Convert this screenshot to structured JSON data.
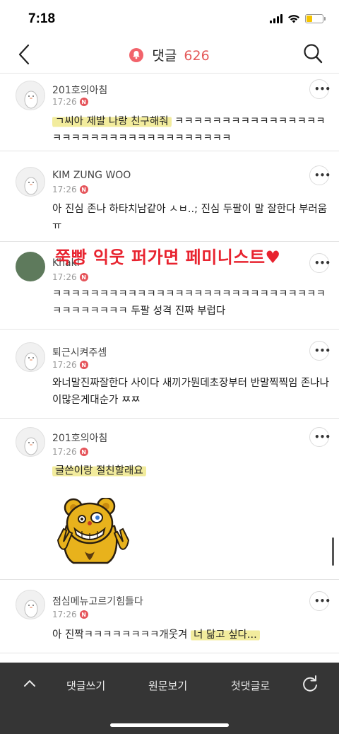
{
  "status_bar": {
    "time": "7:18"
  },
  "header": {
    "title": "댓글",
    "count": "626"
  },
  "overlay_caption": "쭉빵 익웃 퍼가면 페미니스트♥",
  "comments": [
    {
      "author": "201호의아침",
      "time": "17:26",
      "badge": "N",
      "text_highlight": "ㄱ씨아 제발 나랑 친구해줘",
      "text_rest": " ㅋㅋㅋㅋㅋㅋㅋㅋㅋㅋㅋㅋㅋㅋㅋㅋㅋㅋㅋㅋㅋㅋㅋㅋㅋㅋㅋㅋㅋㅋㅋㅋㅋㅋㅋ"
    },
    {
      "author": "KIM ZUNG WOO",
      "time": "17:26",
      "badge": "N",
      "text": "아 진심 존나 하타치남같아 ㅅㅂ..; 진심 두팔이 말 잘한다 부러움 ㅠ"
    },
    {
      "author": "Khaki",
      "time": "17:26",
      "badge": "N",
      "text": "ㅋㅋㅋㅋㅋㅋㅋㅋㅋㅋㅋㅋㅋㅋㅋㅋㅋㅋㅋㅋㅋㅋㅋㅋㅋㅋㅋㅋㅋㅋㅋㅋㅋㅋㅋㅋㅋ 두팔 성격 진짜 부럽다"
    },
    {
      "author": "퇴근시켜주셈",
      "time": "17:26",
      "badge": "N",
      "text": "와너말진짜잘한다 사이다 새끼가뭔데초장부터 반말찍찍임 존나나이많은게대순가 ㅉㅉ"
    },
    {
      "author": "201호의아침",
      "time": "17:26",
      "badge": "N",
      "text_highlight": "글쓴이랑 절친할래요"
    },
    {
      "author": "점심메뉴고르기힘들다",
      "time": "17:26",
      "badge": "N",
      "text_plain": "아 진짝ㅋㅋㅋㅋㅋㅋㅋㅋ개웃겨 ",
      "text_highlight": "너 닮고 싶다..."
    }
  ],
  "bottom_bar": {
    "write": "댓글쓰기",
    "view_original": "원문보기",
    "first_comment": "첫댓글로"
  },
  "icons": {
    "back": "chevron-left-icon",
    "search": "search-icon",
    "bell": "bell-icon",
    "more": "more-dots-icon",
    "up": "chevron-up-icon",
    "refresh": "refresh-icon"
  },
  "colors": {
    "accent": "#e45a5a",
    "highlight": "#f0e88c",
    "bottom_bar": "#353535",
    "caption": "#e8232f"
  }
}
